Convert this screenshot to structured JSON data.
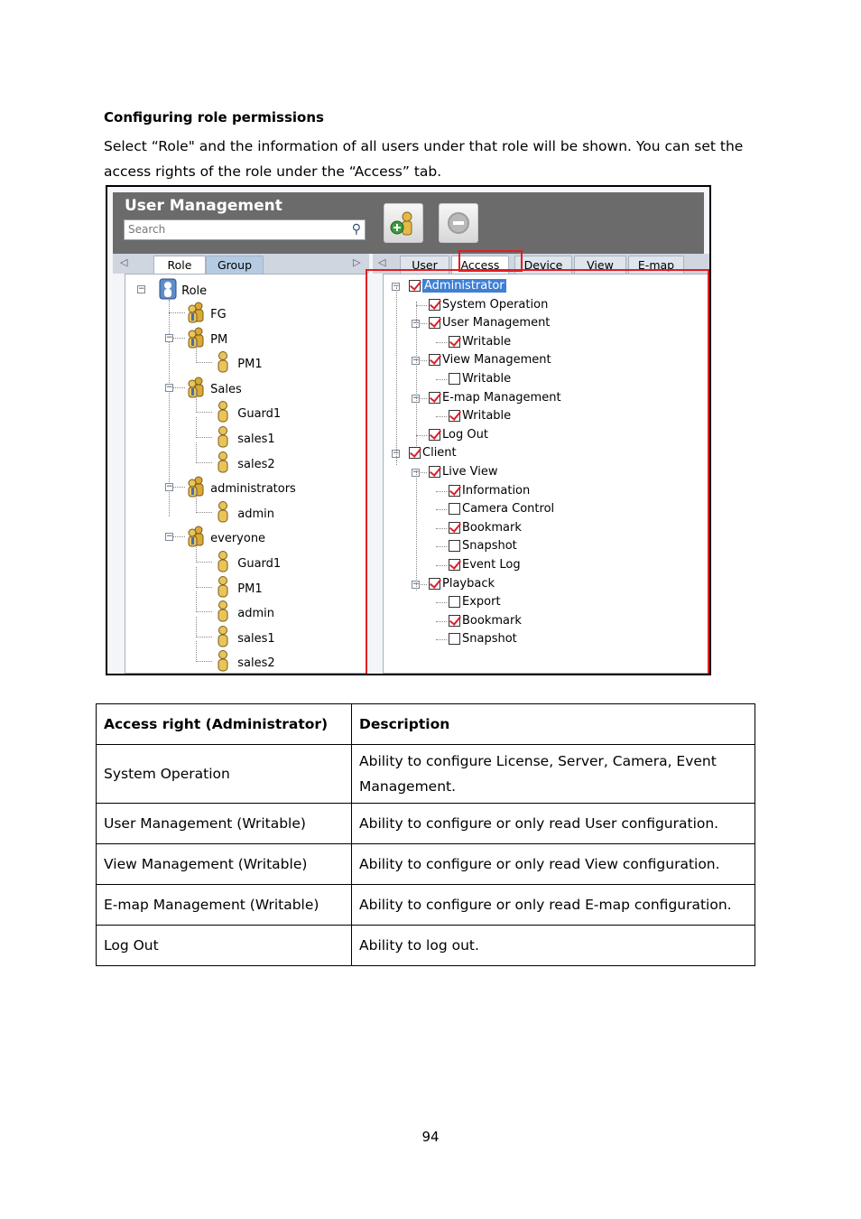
{
  "heading": "Configuring role permissions",
  "paragraph": "Select “Role\" and the information of all users under that role will be shown. You can set the access rights of the role under the “Access” tab.",
  "screenshot": {
    "title": "User Management",
    "search_placeholder": "Search",
    "left_tabs": [
      "Role",
      "Group"
    ],
    "right_tabs": [
      "User",
      "Access",
      "Device",
      "View",
      "E-map"
    ],
    "role_tree": {
      "root": "Role",
      "items": [
        {
          "label": "FG",
          "level": 1
        },
        {
          "label": "PM",
          "level": 1
        },
        {
          "label": "PM1",
          "level": 2
        },
        {
          "label": "Sales",
          "level": 1
        },
        {
          "label": "Guard1",
          "level": 2
        },
        {
          "label": "sales1",
          "level": 2
        },
        {
          "label": "sales2",
          "level": 2
        },
        {
          "label": "administrators",
          "level": 1
        },
        {
          "label": "admin",
          "level": 2
        },
        {
          "label": "everyone",
          "level": 1
        },
        {
          "label": "Guard1",
          "level": 2
        },
        {
          "label": "PM1",
          "level": 2
        },
        {
          "label": "admin",
          "level": 2
        },
        {
          "label": "sales1",
          "level": 2
        },
        {
          "label": "sales2",
          "level": 2
        }
      ]
    },
    "access_tree": [
      {
        "label": "Administrator",
        "level": 0,
        "checked": true
      },
      {
        "label": "System Operation",
        "level": 1,
        "checked": true
      },
      {
        "label": "User Management",
        "level": 1,
        "checked": true
      },
      {
        "label": "Writable",
        "level": 2,
        "checked": true
      },
      {
        "label": "View Management",
        "level": 1,
        "checked": true
      },
      {
        "label": "Writable",
        "level": 2,
        "checked": false
      },
      {
        "label": "E-map Management",
        "level": 1,
        "checked": true
      },
      {
        "label": "Writable",
        "level": 2,
        "checked": true
      },
      {
        "label": "Log Out",
        "level": 1,
        "checked": true
      },
      {
        "label": "Client",
        "level": 0,
        "checked": true
      },
      {
        "label": "Live View",
        "level": 1,
        "checked": true
      },
      {
        "label": "Information",
        "level": 2,
        "checked": true
      },
      {
        "label": "Camera Control",
        "level": 2,
        "checked": false
      },
      {
        "label": "Bookmark",
        "level": 2,
        "checked": true
      },
      {
        "label": "Snapshot",
        "level": 2,
        "checked": false
      },
      {
        "label": "Event Log",
        "level": 2,
        "checked": true
      },
      {
        "label": "Playback",
        "level": 1,
        "checked": true
      },
      {
        "label": "Export",
        "level": 2,
        "checked": false
      },
      {
        "label": "Bookmark",
        "level": 2,
        "checked": true
      },
      {
        "label": "Snapshot",
        "level": 2,
        "checked": false
      }
    ]
  },
  "table": {
    "headers": [
      "Access right (Administrator)",
      "Description"
    ],
    "rows": [
      [
        "System Operation",
        "Ability to configure License, Server, Camera, Event Management."
      ],
      [
        "User Management (Writable)",
        "Ability to configure or only read User configuration."
      ],
      [
        "View Management (Writable)",
        "Ability to configure or only read View configuration."
      ],
      [
        "E-map Management (Writable)",
        "Ability to configure or only read E-map configuration."
      ],
      [
        "Log Out",
        "Ability to log out."
      ]
    ]
  },
  "page_number": "94"
}
